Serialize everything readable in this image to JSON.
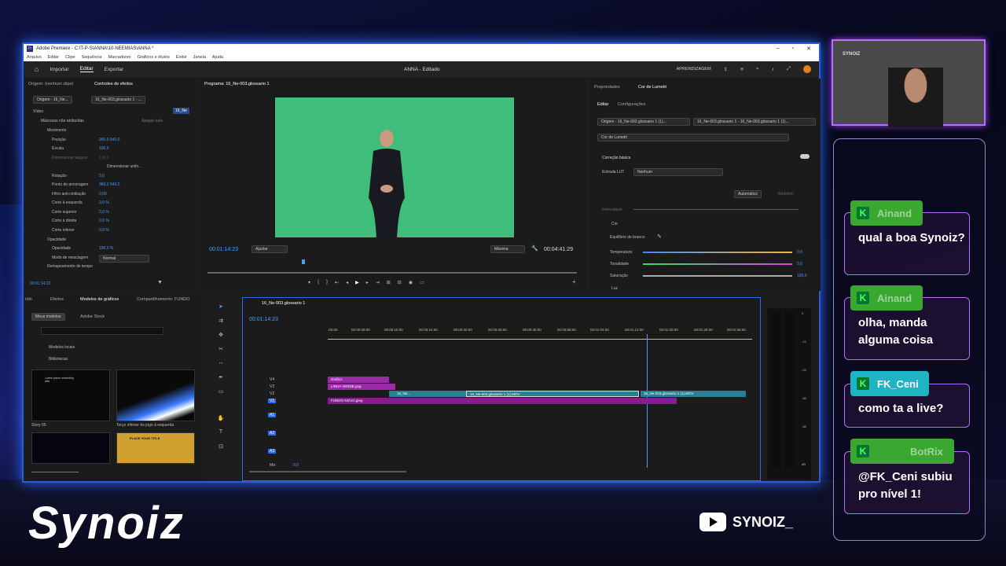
{
  "app": {
    "title": "Adobe Premiere - C:\\T-P-S\\ANNA\\10-NEEMIAS\\ANNA *",
    "menu": [
      "Arquivo",
      "Editar",
      "Clipe",
      "Sequência",
      "Marcadores",
      "Gráficos e títulos",
      "Exibir",
      "Janela",
      "Ajuda"
    ],
    "tabs": [
      "Importar",
      "Editar",
      "Exportar"
    ],
    "project": "ANNA",
    "project_status": "- Editado",
    "learning": "APRENDIZAGEM"
  },
  "effects": {
    "tab_origin": "Origem: (nenhum clipe)",
    "tab_controls": "Controles de efeitos",
    "clip_origin": "Origem - 16_Ne...",
    "clip_seq": "16_Ne-003.glossario 1 - ...",
    "clip_thumb": "16_Ne",
    "video_label": "Vídeo",
    "masks": "Máscaras não atribuídas",
    "apagar": "Apagar tudo",
    "rows": [
      {
        "label": "Movimento",
        "value": ""
      },
      {
        "label": "Posição",
        "value": "960,0      540,0"
      },
      {
        "label": "Escala",
        "value": "100,0"
      },
      {
        "label": "Dimensionar largura",
        "value": "100,0"
      },
      {
        "label": "Dimensionar unifo...",
        "value": ""
      },
      {
        "label": "Rotação",
        "value": "0,0"
      },
      {
        "label": "Ponto de ancoragem",
        "value": "960,0      540,0"
      },
      {
        "label": "Filtro anti-cintilação",
        "value": "0,00"
      },
      {
        "label": "Corte à esquerda",
        "value": "0,0 %"
      },
      {
        "label": "Corte superior",
        "value": "0,0 %"
      },
      {
        "label": "Corte à direita",
        "value": "0,0 %"
      },
      {
        "label": "Corte inferior",
        "value": "0,0 %"
      },
      {
        "label": "Opacidade",
        "value": ""
      },
      {
        "label": "Opacidade",
        "value": "100,0 %"
      },
      {
        "label": "Modo de mesclagem",
        "value": "Normal"
      },
      {
        "label": "Remapeamento de tempo",
        "value": ""
      }
    ],
    "time": "00:01:14:22"
  },
  "program": {
    "title": "Programa: 16_Ne-003.glossario 1",
    "timecode": "00:01:14:23",
    "fit": "Ajustar",
    "quality": "Máxima",
    "duration": "00:04:41:29"
  },
  "lumetri": {
    "tab_props": "Propriedades",
    "tab_lumetri": "Cor de Lumetri",
    "sub_edit": "Editar",
    "sub_config": "Configurações",
    "origin": "Origem - 16_Ne-003.glossario 1 (1)...",
    "seq": "16_Ne-003.glossario 1 - 16_Ne-003.glossario 1 (1)...",
    "effect": "Cor de Lumetri",
    "basic": "Correção básica",
    "lut_label": "Entrada LUT",
    "lut_value": "Nenhum",
    "auto": "Automático",
    "reset": "Redefinir",
    "intensity": "Intensidade",
    "cor": "Cor",
    "wb": "Equilíbrio de branco",
    "temp": "Temperatura",
    "temp_val": "0,0",
    "tint": "Tonalidade",
    "tint_val": "0,0",
    "sat": "Saturação",
    "sat_val": "100,0",
    "luz": "Luz"
  },
  "graphics": {
    "tabs": [
      "ídio",
      "Efeitos",
      "Modelos de gráficos",
      "Compartilhamento: FUNDO"
    ],
    "my": "Meus modelos",
    "stock": "Adobe Stock",
    "local": "Modelos locais",
    "libs": "Bibliotecas",
    "t1": "Story 05",
    "t2": "Terço inferior do jogo à esquerda",
    "t1_text": "Lorem ipsum marketing atta",
    "t3_text": "PLACE YOUR TITLE"
  },
  "timeline": {
    "title": "16_Ne-003.glossario 1",
    "timecode": "00:01:14:23",
    "ruler": [
      ":00:00",
      "00:00:08:00",
      "00:00:16:00",
      "00:00:24:00",
      "00:00:32:00",
      "00:00:40:00",
      "00:00:48:00",
      "00:00:56:00",
      "00:01:04:00",
      "00:01:12:00",
      "00:01:20:00",
      "00:01:28:00",
      "00:01:36:00"
    ],
    "vtracks": [
      "V4",
      "V3",
      "V2",
      "V1"
    ],
    "atracks": [
      "A1",
      "A2",
      "A3"
    ],
    "mix": "Mix",
    "mix_val": "0,0",
    "clips": {
      "grafico": "Gráfico",
      "linha": "LINHA VERDE.png",
      "c1": "16_Ne...",
      "c2": "16_Ne-003.glossario 1 (1).MOV",
      "c3": "16_Ne-003.glossario 1 (1).MOV",
      "fundo": "FUNDO-NOVO.jpeg"
    },
    "meter": [
      "0",
      "-6",
      "-12",
      "-18",
      "-24",
      "-30",
      "-36",
      "-42",
      "-48",
      "-54",
      "dB"
    ]
  },
  "chat": [
    {
      "user": "Ainand",
      "text": "qual a boa Synoiz?"
    },
    {
      "user": "Ainand",
      "text": "olha, manda alguma coisa"
    },
    {
      "user": "FK_Ceni",
      "text": "como ta a live?"
    },
    {
      "user": "BotRix",
      "text": "@FK_Ceni subiu pro nível 1!"
    }
  ],
  "brand": {
    "logo": "Synoiz",
    "yt": "SYNOIZ_",
    "cam_sign": "SYNOIZ"
  }
}
